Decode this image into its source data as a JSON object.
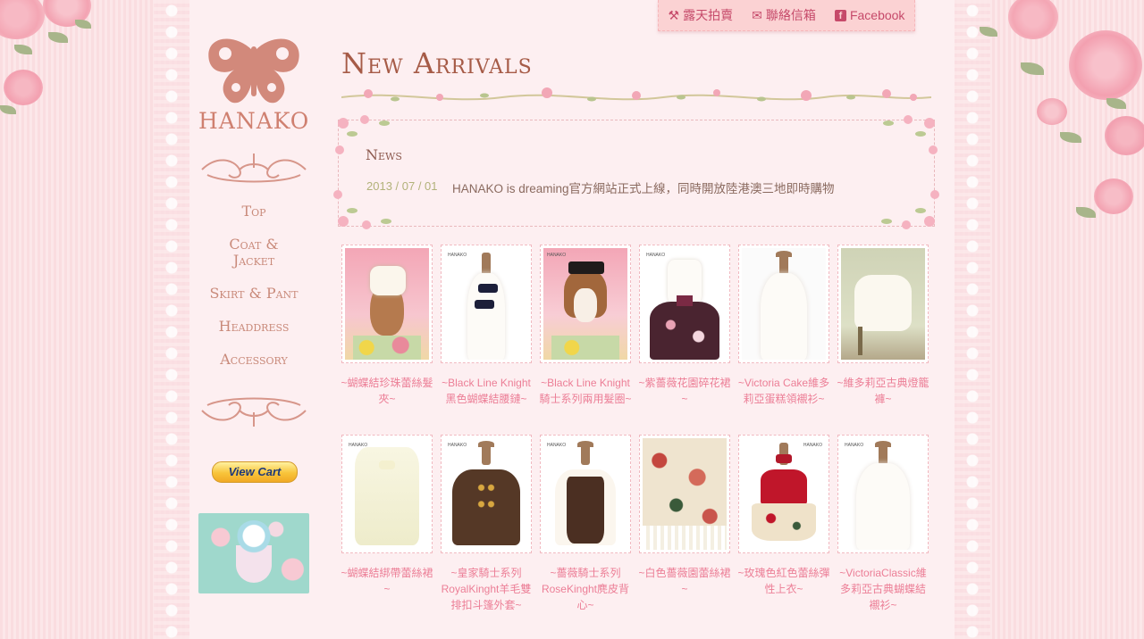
{
  "topbar": {
    "auction": "露天拍賣",
    "mailbox": "聯絡信箱",
    "facebook": "Facebook"
  },
  "sidebar": {
    "logo_text": "HANAKO",
    "nav": [
      {
        "label": "Top"
      },
      {
        "label": "Coat &",
        "label2": "Jacket"
      },
      {
        "label": "Skirt & Pant"
      },
      {
        "label": "Headdress"
      },
      {
        "label": "Accessory"
      }
    ],
    "cart_label": "View Cart"
  },
  "main": {
    "title": "New Arrivals",
    "news": {
      "heading": "News",
      "date": "2013 / 07 / 01",
      "text": "HANAKO is dreaming官方網站正式上線，同時開放陸港澳三地即時購物"
    },
    "products": [
      {
        "caption": "~蝴蝶結珍珠蕾絲髮夾~",
        "style": "hair-white"
      },
      {
        "caption": "~Black Line Knight黑色蝴蝶結腰鏈~",
        "style": "blouse-bows"
      },
      {
        "caption": "~Black Line Knight騎士系列兩用髮圈~",
        "style": "hair-black"
      },
      {
        "caption": "~紫薔薇花園碎花裙~",
        "style": "floral-skirt"
      },
      {
        "caption": "~Victoria Cake維多莉亞蛋糕領襯衫~",
        "style": "blouse-white"
      },
      {
        "caption": "~維多莉亞古典燈籠褲~",
        "style": "bloomers"
      },
      {
        "caption": "~蝴蝶結綁帶蕾絲裙~",
        "style": "tulle-skirt"
      },
      {
        "caption": "~皇家騎士系列RoyalKinght羊毛雙排扣斗篷外套~",
        "style": "brown-coat"
      },
      {
        "caption": "~薔薇騎士系列RoseKinght麂皮背心~",
        "style": "vest"
      },
      {
        "caption": "~白色薔薇園蕾絲裙~",
        "style": "rose-skirt"
      },
      {
        "caption": "~玫瑰色紅色蕾絲彈性上衣~",
        "style": "red-top"
      },
      {
        "caption": "~VictoriaClassic維多莉亞古典蝴蝶結襯衫~",
        "style": "classic-blouse"
      }
    ]
  },
  "colors": {
    "background": "#fbe4e6",
    "title": "#a65b47",
    "caption": "#ec7e96",
    "topbar": "#fbd2d3",
    "link": "#c64a6a"
  }
}
